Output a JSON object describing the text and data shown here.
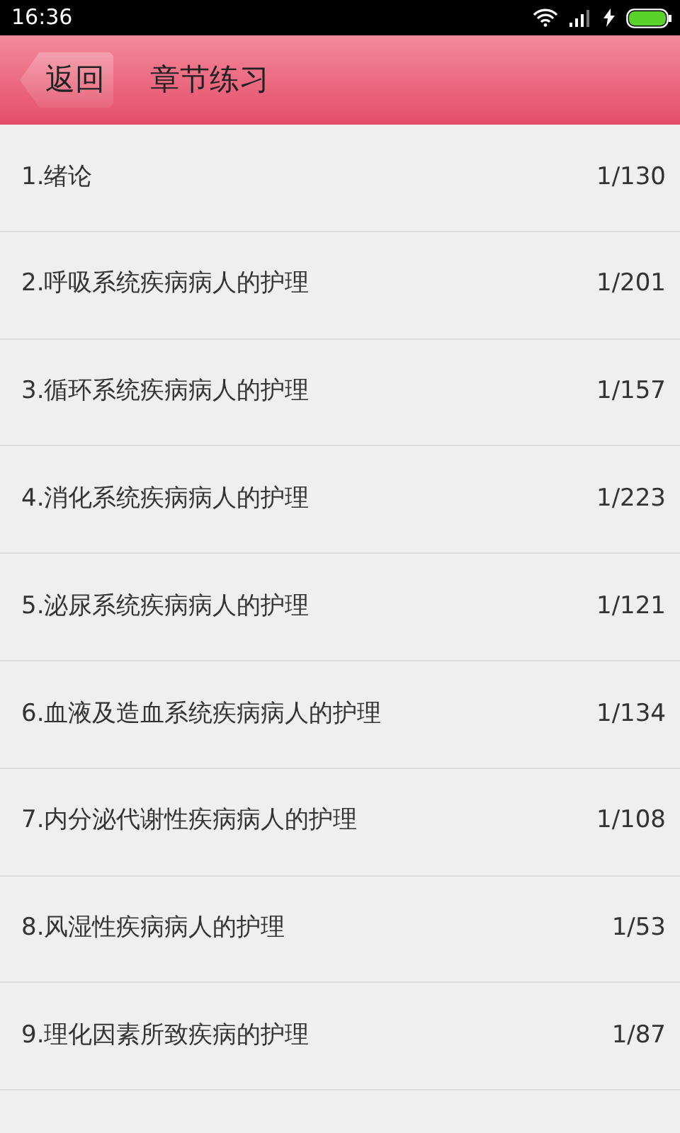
{
  "status_bar": {
    "time": "16:36"
  },
  "header": {
    "back_label": "返回",
    "title": "章节练习"
  },
  "chapters": [
    {
      "title": "1.绪论",
      "progress": "1/130"
    },
    {
      "title": "2.呼吸系统疾病病人的护理",
      "progress": "1/201"
    },
    {
      "title": "3.循环系统疾病病人的护理",
      "progress": "1/157"
    },
    {
      "title": "4.消化系统疾病病人的护理",
      "progress": "1/223"
    },
    {
      "title": "5.泌尿系统疾病病人的护理",
      "progress": "1/121"
    },
    {
      "title": "6.血液及造血系统疾病病人的护理",
      "progress": "1/134"
    },
    {
      "title": "7.内分泌代谢性疾病病人的护理",
      "progress": "1/108"
    },
    {
      "title": "8.风湿性疾病病人的护理",
      "progress": "1/53"
    },
    {
      "title": "9.理化因素所致疾病的护理",
      "progress": "1/87"
    }
  ]
}
